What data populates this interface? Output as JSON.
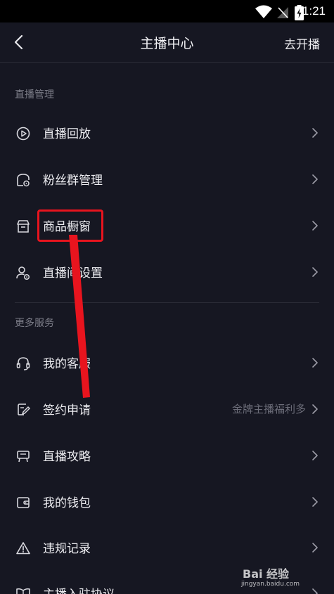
{
  "status_bar": {
    "time": "1:21"
  },
  "nav": {
    "title": "主播中心",
    "action": "去开播"
  },
  "sections": [
    {
      "header": "直播管理",
      "items": [
        {
          "label": "直播回放",
          "icon": "play-circle-icon",
          "hint": ""
        },
        {
          "label": "粉丝群管理",
          "icon": "fan-group-icon",
          "hint": ""
        },
        {
          "label": "商品橱窗",
          "icon": "store-icon",
          "hint": ""
        },
        {
          "label": "直播间设置",
          "icon": "user-settings-icon",
          "hint": ""
        }
      ]
    },
    {
      "header": "更多服务",
      "items": [
        {
          "label": "我的客服",
          "icon": "headset-icon",
          "hint": ""
        },
        {
          "label": "签约申请",
          "icon": "sign-pen-icon",
          "hint": "金牌主播福利多"
        },
        {
          "label": "直播攻略",
          "icon": "billboard-icon",
          "hint": ""
        },
        {
          "label": "我的钱包",
          "icon": "wallet-icon",
          "hint": ""
        },
        {
          "label": "违规记录",
          "icon": "warning-icon",
          "hint": ""
        },
        {
          "label": "主播入驻协议",
          "icon": "book-icon",
          "hint": ""
        }
      ]
    }
  ],
  "watermark": {
    "logo": "Bai 经验",
    "url": "jingyan.baidu.com"
  },
  "colors": {
    "background": "#161722",
    "highlight": "#e8141e",
    "hint": "#6b6c78"
  }
}
